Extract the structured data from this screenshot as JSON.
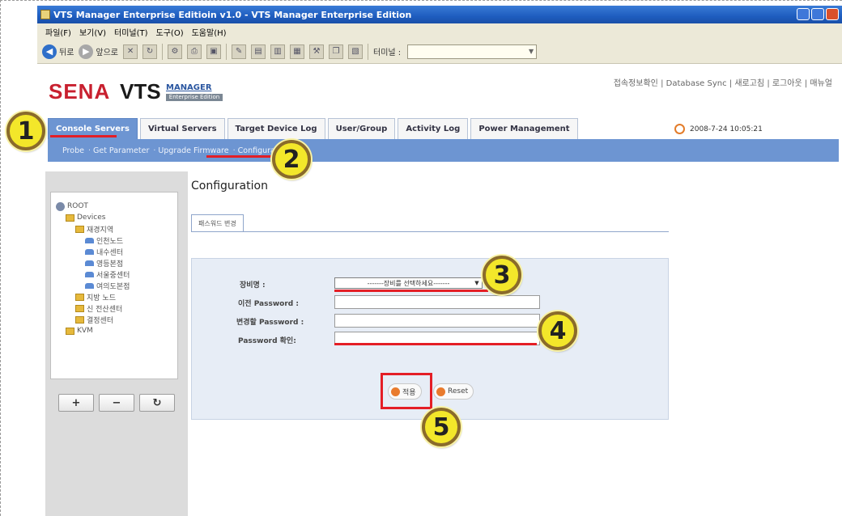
{
  "window": {
    "title": "VTS Manager Enterprise Editioin v1.0 - VTS Manager Enterprise Edition"
  },
  "menubar": [
    "파일(F)",
    "보기(V)",
    "터미널(T)",
    "도구(O)",
    "도움말(H)"
  ],
  "toolbar": {
    "back_label": "뒤로",
    "forward_label": "앞으로",
    "terminal_label": "터미널 :"
  },
  "brand": {
    "sena": "SENA",
    "vts": "VTS",
    "manager": "MANAGER",
    "edition": "Enterprise Edition"
  },
  "toplinks": "접속정보확인 | Database Sync | 새로고침 | 로그아웃 | 매뉴얼",
  "tabs": [
    {
      "label": "Console Servers",
      "active": true
    },
    {
      "label": "Virtual Servers",
      "active": false
    },
    {
      "label": "Target Device Log",
      "active": false
    },
    {
      "label": "User/Group",
      "active": false
    },
    {
      "label": "Activity Log",
      "active": false
    },
    {
      "label": "Power Management",
      "active": false
    }
  ],
  "datetime": "2008-7-24  10:05:21",
  "subnav": [
    "Probe",
    "Get Parameter",
    "Upgrade Firmware",
    "Configuration"
  ],
  "tree": [
    {
      "label": "ROOT",
      "indent": 0,
      "icon": "root-icon"
    },
    {
      "label": "Devices",
      "indent": 1,
      "icon": "folder-icon"
    },
    {
      "label": "재경지역",
      "indent": 2,
      "icon": "folder-icon"
    },
    {
      "label": "인천노드",
      "indent": 3,
      "icon": "device-icon"
    },
    {
      "label": "내수센터",
      "indent": 3,
      "icon": "device-icon"
    },
    {
      "label": "영등본점",
      "indent": 3,
      "icon": "device-icon"
    },
    {
      "label": "서울중센터",
      "indent": 3,
      "icon": "device-icon"
    },
    {
      "label": "여의도본점",
      "indent": 3,
      "icon": "device-icon"
    },
    {
      "label": "지방 노드",
      "indent": 2,
      "icon": "folder-icon"
    },
    {
      "label": "신 전산센터",
      "indent": 2,
      "icon": "folder-icon"
    },
    {
      "label": "결정센터",
      "indent": 2,
      "icon": "folder-icon"
    },
    {
      "label": "KVM",
      "indent": 1,
      "icon": "folder-icon"
    }
  ],
  "tree_buttons": {
    "add": "+",
    "remove": "−",
    "refresh": "↻"
  },
  "page": {
    "title": "Configuration",
    "subtab": "패스워드 변경"
  },
  "form": {
    "device_label": "장비명 :",
    "device_select": "-------장비를 선택하세요-------",
    "old_password_label": "이전 Password :",
    "new_password_label": "변경할 Password :",
    "confirm_password_label": "Password 확인:",
    "apply_label": "적용",
    "reset_label": "Reset"
  },
  "callouts": [
    "1",
    "2",
    "3",
    "4",
    "5"
  ],
  "colors": {
    "accent": "#6d95d2",
    "highlight": "#e41e26",
    "callout": "#f3e72a"
  }
}
